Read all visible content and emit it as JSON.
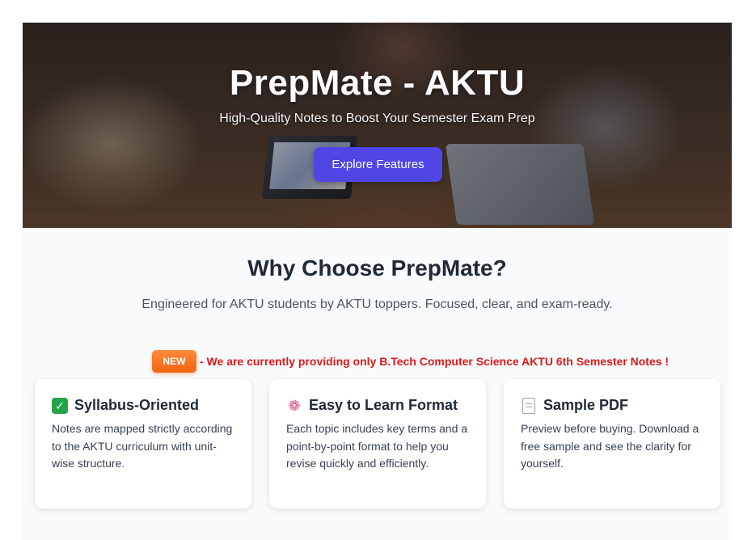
{
  "hero": {
    "title": "PrepMate - AKTU",
    "subtitle": "High-Quality Notes to Boost Your Semester Exam Prep",
    "button_label": "Explore Features"
  },
  "why": {
    "title": "Why Choose PrepMate?",
    "subtitle": "Engineered for AKTU students by AKTU toppers. Focused, clear, and exam-ready."
  },
  "notice": {
    "badge": "NEW",
    "text": "- We are currently providing only B.Tech Computer Science AKTU 6th Semester Notes !"
  },
  "features": [
    {
      "icon": "check-icon",
      "title": "Syllabus-Oriented",
      "description": "Notes are mapped strictly according to the AKTU curriculum with unit-wise structure."
    },
    {
      "icon": "brain-icon",
      "title": "Easy to Learn Format",
      "description": "Each topic includes key terms and a point-by-point format to help you revise quickly and efficiently."
    },
    {
      "icon": "document-icon",
      "title": "Sample PDF",
      "description": "Preview before buying. Download a free sample and see the clarity for yourself."
    }
  ],
  "colors": {
    "accent": "#4f46e5",
    "notice_red": "#dc1a1a",
    "badge_orange": "#f26411"
  }
}
